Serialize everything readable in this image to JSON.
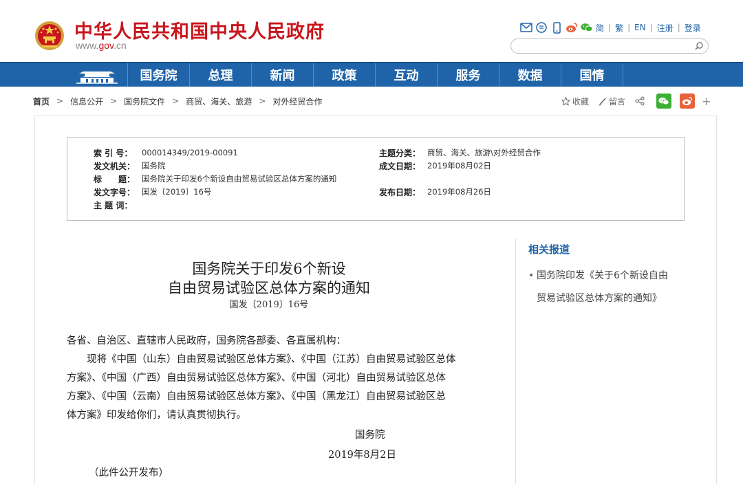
{
  "header": {
    "site_title": "中华人民共和国中央人民政府",
    "site_url_prefix": "www.",
    "site_url_domain": "gov",
    "site_url_suffix": ".cn",
    "lang_simplified": "简",
    "lang_traditional": "繁",
    "lang_english": "EN",
    "register": "注册",
    "login": "登录",
    "search_placeholder": ""
  },
  "nav": {
    "items": [
      "国务院",
      "总理",
      "新闻",
      "政策",
      "互动",
      "服务",
      "数据",
      "国情"
    ]
  },
  "breadcrumb": {
    "home": "首页",
    "items": [
      "信息公开",
      "国务院文件",
      "商贸、海关、旅游",
      "对外经贸合作"
    ]
  },
  "actions": {
    "favorite": "收藏",
    "comment": "留言"
  },
  "meta": {
    "index_label": "索 引 号：",
    "index_value": "000014349/2019-00091",
    "topic_label": "主题分类：",
    "topic_value": "商贸、海关、旅游\\对外经贸合作",
    "issuer_label": "发文机关：",
    "issuer_value": "国务院",
    "date_written_label": "成文日期：",
    "date_written_value": "2019年08月02日",
    "title_label": "标　　题：",
    "title_value": "国务院关于印发6个新设自由贸易试验区总体方案的通知",
    "doc_no_label": "发文字号：",
    "doc_no_value": "国发〔2019〕16号",
    "publish_date_label": "发布日期：",
    "publish_date_value": "2019年08月26日",
    "keywords_label": "主 题 词：",
    "keywords_value": ""
  },
  "document": {
    "title_line1": "国务院关于印发6个新设",
    "title_line2": "自由贸易试验区总体方案的通知",
    "doc_number": "国发〔2019〕16号",
    "salutation": "各省、自治区、直辖市人民政府，国务院各部委、各直属机构：",
    "para_lines": [
      "　　现将《中国（山东）自由贸易试验区总体方案》、《中国（江苏）自由贸易试验区总体",
      "方案》、《中国（广西）自由贸易试验区总体方案》、《中国（河北）自由贸易试验区总体",
      "方案》、《中国（云南）自由贸易试验区总体方案》、《中国（黑龙江）自由贸易试验区总",
      "体方案》印发给你们，请认真贯彻执行。"
    ],
    "signature": "国务院",
    "sign_date": "2019年8月2日",
    "note": "（此件公开发布）"
  },
  "sidebar": {
    "title": "相关报道",
    "item_bullet": "•",
    "item_line1": "国务院印发《关于6个新设自由",
    "item_line2": "贸易试验区总体方案的通知》"
  },
  "colors": {
    "brand_red": "#c8161d",
    "nav_blue": "#1f63a8",
    "wechat_green": "#3cb034",
    "weibo_orange": "#e8623a"
  }
}
